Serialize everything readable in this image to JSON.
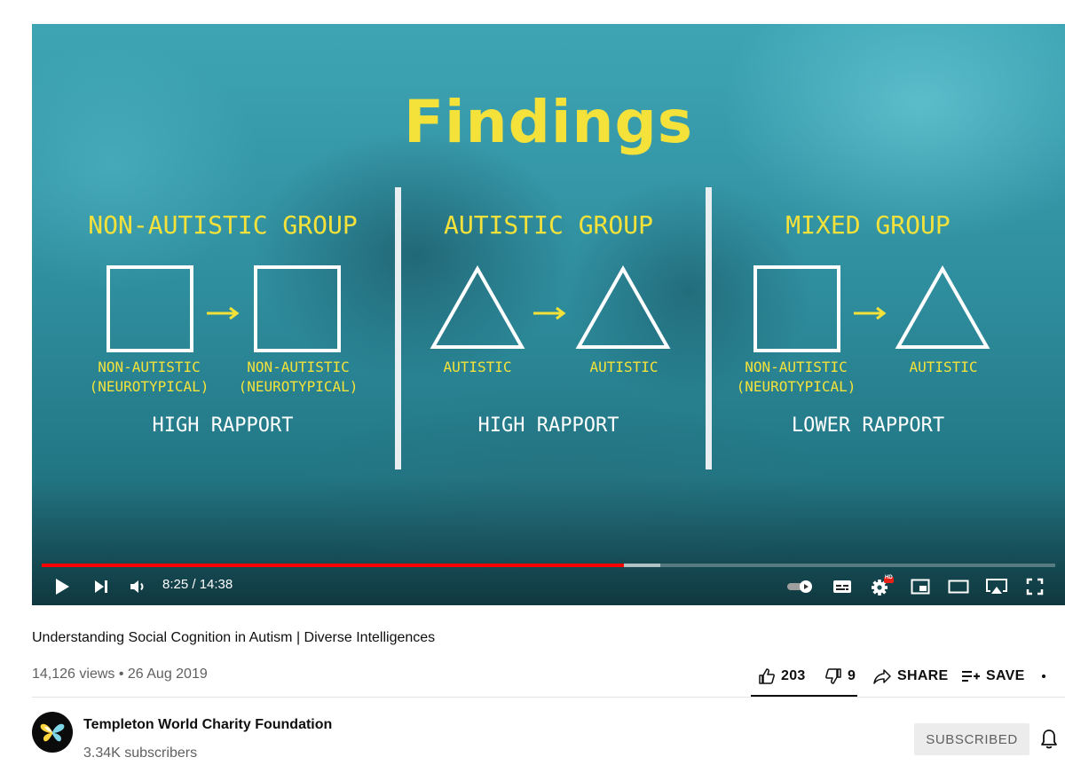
{
  "player": {
    "slide": {
      "title": "Findings",
      "groups": [
        {
          "title": "NON-AUTISTIC GROUP",
          "left_shape": "square",
          "right_shape": "square",
          "left_label_line1": "NON-AUTISTIC",
          "left_label_line2": "(NEUROTYPICAL)",
          "right_label_line1": "NON-AUTISTIC",
          "right_label_line2": "(NEUROTYPICAL)",
          "rapport": "HIGH RAPPORT"
        },
        {
          "title": "AUTISTIC GROUP",
          "left_shape": "triangle",
          "right_shape": "triangle",
          "left_label_line1": "AUTISTIC",
          "right_label_line1": "AUTISTIC",
          "rapport": "HIGH RAPPORT"
        },
        {
          "title": "MIXED GROUP",
          "left_shape": "square",
          "right_shape": "triangle",
          "left_label_line1": "NON-AUTISTIC",
          "left_label_line2": "(NEUROTYPICAL)",
          "right_label_line1": "AUTISTIC",
          "rapport": "LOWER RAPPORT"
        }
      ],
      "colors": {
        "accent_yellow": "#f4e23b",
        "slide_bg": "#2f8e9e"
      }
    },
    "controls": {
      "time_display": "8:25 / 14:38",
      "progress_fraction": 0.574,
      "buffered_fraction": 0.61,
      "progress_color": "#ff0000",
      "icons": [
        "play-icon",
        "next-icon",
        "volume-icon",
        "autoplay-toggle-icon",
        "subtitles-icon",
        "settings-icon",
        "miniplayer-icon",
        "theater-mode-icon",
        "cast-icon",
        "fullscreen-icon"
      ],
      "settings_badge": "HD"
    }
  },
  "video": {
    "title": "Understanding Social Cognition in Autism | Diverse Intelligences",
    "view_info": "14,126 views • 26 Aug 2019",
    "likes": "203",
    "dislikes": "9",
    "share_label": "SHARE",
    "save_label": "SAVE"
  },
  "channel": {
    "name": "Templeton World Charity Foundation",
    "subscribers": "3.34K subscribers",
    "subscribe_label": "SUBSCRIBED"
  }
}
